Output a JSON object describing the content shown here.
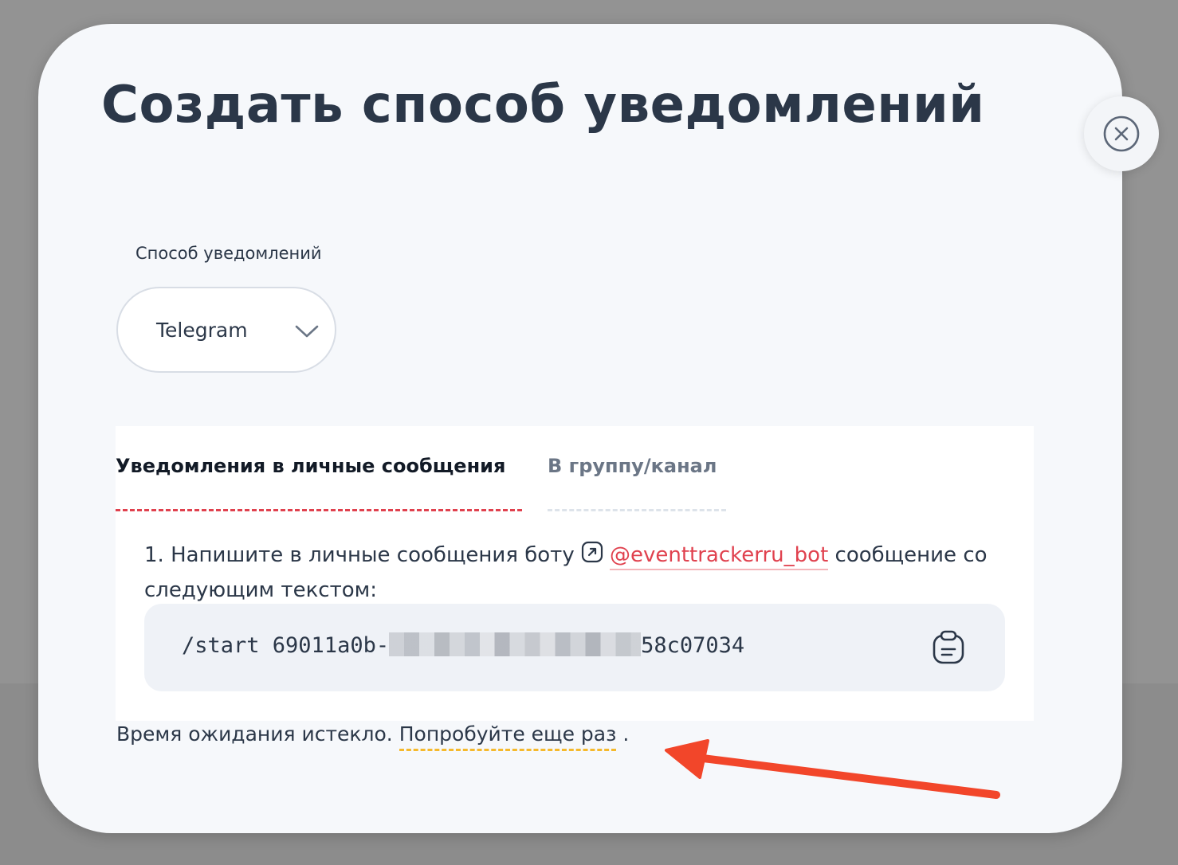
{
  "modal": {
    "title": "Создать способ уведомлений",
    "close_icon": "close-circle-icon"
  },
  "notification_method": {
    "label": "Способ уведомлений",
    "selected": "Telegram",
    "chevron_icon": "chevron-down-icon"
  },
  "tabs": [
    {
      "label": "Уведомления в личные сообщения",
      "active": true
    },
    {
      "label": "В группу/канал",
      "active": false
    }
  ],
  "instruction": {
    "prefix": "1. Напишите в личные сообщения боту",
    "link_icon": "external-link-icon",
    "bot_name": "@eventtrackerru_bot",
    "suffix": "сообщение со следующим текстом:"
  },
  "command": {
    "visible_start": "/start 69011a0b-",
    "visible_end": "58c07034",
    "copy_icon": "clipboard-icon"
  },
  "status": {
    "message": "Время ожидания истекло.",
    "retry_link": "Попробуйте еще раз",
    "trailing": "."
  },
  "colors": {
    "accent": "#e0414e",
    "text": "#2b3748",
    "retry_underline": "#f5b92c",
    "annotation_arrow": "#f2462a"
  }
}
